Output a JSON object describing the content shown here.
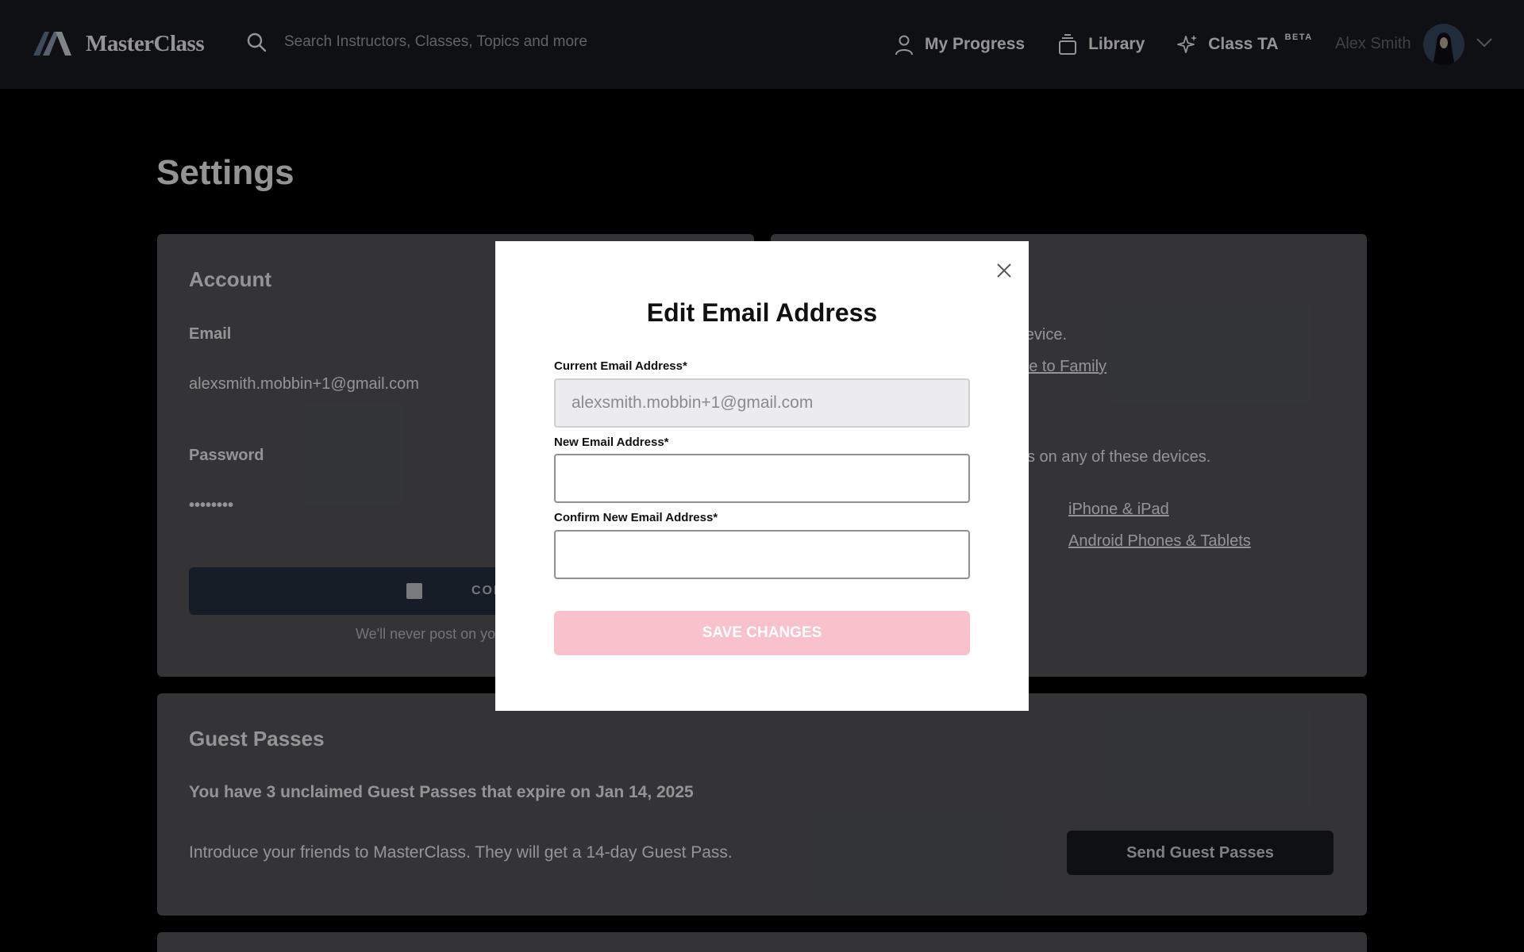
{
  "nav": {
    "logo_text": "MasterClass",
    "search_placeholder": "Search Instructors, Classes, Topics and more",
    "my_progress": "My Progress",
    "library": "Library",
    "class_ta": "Class TA",
    "beta": "BETA",
    "user_name": "Alex Smith"
  },
  "page": {
    "title": "Settings"
  },
  "account": {
    "title": "Account",
    "email_label": "Email",
    "email_value": "alexsmith.mobbin+1@gmail.com",
    "password_label": "Password",
    "password_value": "••••••••",
    "facebook_button": "CONNEC",
    "facebook_note": "We'll never post on yo"
  },
  "plan": {
    "devices_text": "1 device.",
    "upgrade_link": "ade to Family",
    "access_text": "ss on any of these devices.",
    "iphone_link": "iPhone & iPad",
    "android_link": "Android Phones & Tablets"
  },
  "guest_passes": {
    "title": "Guest Passes",
    "headline": "You have 3 unclaimed Guest Passes that expire on Jan 14, 2025",
    "description": "Introduce your friends to MasterClass. They will get a 14-day Guest Pass.",
    "button": "Send Guest Passes"
  },
  "modal": {
    "title": "Edit Email Address",
    "current_label": "Current Email Address*",
    "current_value": "alexsmith.mobbin+1@gmail.com",
    "new_label": "New Email Address*",
    "new_value": "",
    "confirm_label": "Confirm New Email Address*",
    "confirm_value": "",
    "save_button": "SAVE CHANGES"
  },
  "colors": {
    "save_disabled": "#f8c1cc",
    "nav_bg": "#1a1c21",
    "card_bg": "#5a5b5e"
  }
}
